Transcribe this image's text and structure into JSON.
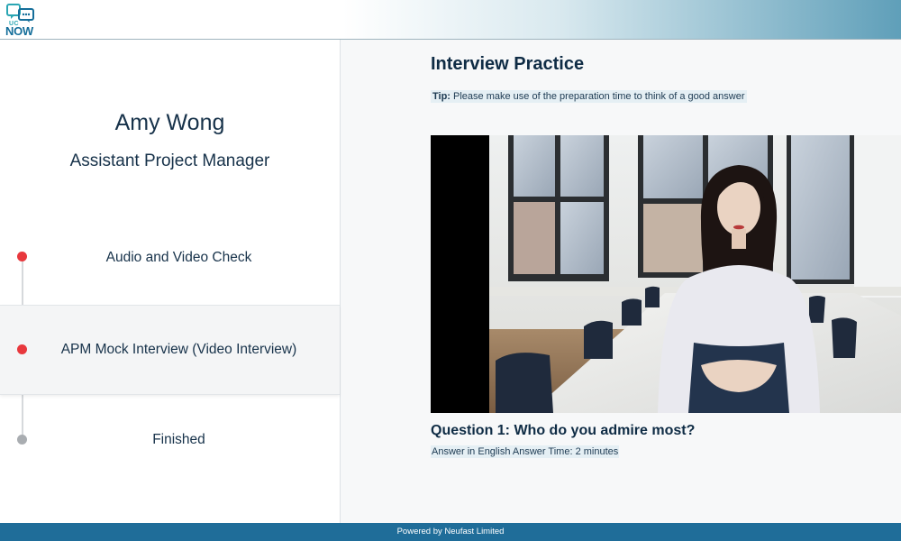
{
  "header": {
    "logo": {
      "small_text": "UC",
      "main_text": "NOW"
    }
  },
  "sidebar": {
    "name": "Amy Wong",
    "role": "Assistant Project Manager",
    "steps": [
      {
        "label": "Audio and Video Check",
        "status": "done"
      },
      {
        "label": "APM Mock Interview (Video Interview)",
        "status": "current"
      },
      {
        "label": "Finished",
        "status": "pending"
      }
    ]
  },
  "main": {
    "title": "Interview Practice",
    "tip_label": "Tip:",
    "tip_text": " Please make use of the preparation time to think of a good answer",
    "question": "Question 1: Who do you admire most?",
    "answer_info": "Answer in English Answer Time: 2 minutes"
  },
  "footer": {
    "text": "Powered by Neufast Limited"
  },
  "colors": {
    "accent": "#1f6d99",
    "step_active_dot": "#e8383d",
    "step_pending_dot": "#a9adb1",
    "title_text": "#0f2c45"
  }
}
